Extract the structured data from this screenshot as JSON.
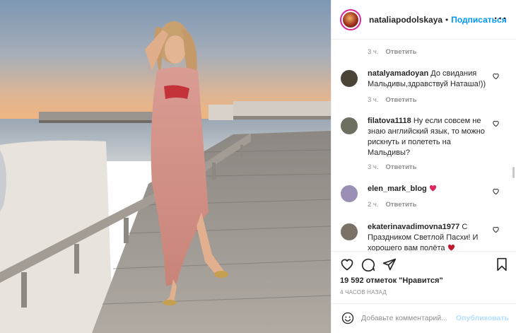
{
  "post": {
    "username": "nataliapodolskaya",
    "separator": "•",
    "follow_label": "Подписаться",
    "more_label": "···",
    "first_meta": {
      "time": "3 ч.",
      "reply": "Ответить"
    },
    "comments": [
      {
        "user": "natalyamadoyan",
        "text": "До свидания Мальдивы,здравствуй Наташа!))",
        "time": "3 ч.",
        "reply": "Ответить",
        "avatar_color": "#4a4438"
      },
      {
        "user": "filatova1118",
        "text": "Ну если совсем не знаю английский язык, то можно рискнуть и полететь на Мальдивы?",
        "time": "3 ч.",
        "reply": "Ответить",
        "avatar_color": "#6d7060"
      },
      {
        "user": "elen_mark_blog",
        "text": "",
        "emoji": "heart-emoji",
        "time": "2 ч.",
        "reply": "Ответить",
        "avatar_color": "#9b8fb5"
      },
      {
        "user": "ekaterinavadimovna1977",
        "text": "С Праздником Светлой Пасхи! И хорошего вам полёта",
        "time": "",
        "reply": "",
        "avatar_color": "#7a7266"
      }
    ],
    "likes": "19 592 отметок \"Нравится\"",
    "time_ago": "4 часов назад",
    "add_comment_placeholder": "Добавьте комментарий...",
    "publish_label": "Опубликовать",
    "icons": {
      "like": "heart-outline-icon",
      "comment": "comment-bubble-icon",
      "share": "paper-plane-icon",
      "save": "bookmark-icon",
      "emoji": "smiley-icon",
      "comment_like": "small-heart-icon"
    },
    "colors": {
      "link": "#0095f6",
      "publish_disabled": "#b2dffc",
      "muted": "#8e8e8e",
      "heart_emoji": "#e0245e"
    }
  }
}
